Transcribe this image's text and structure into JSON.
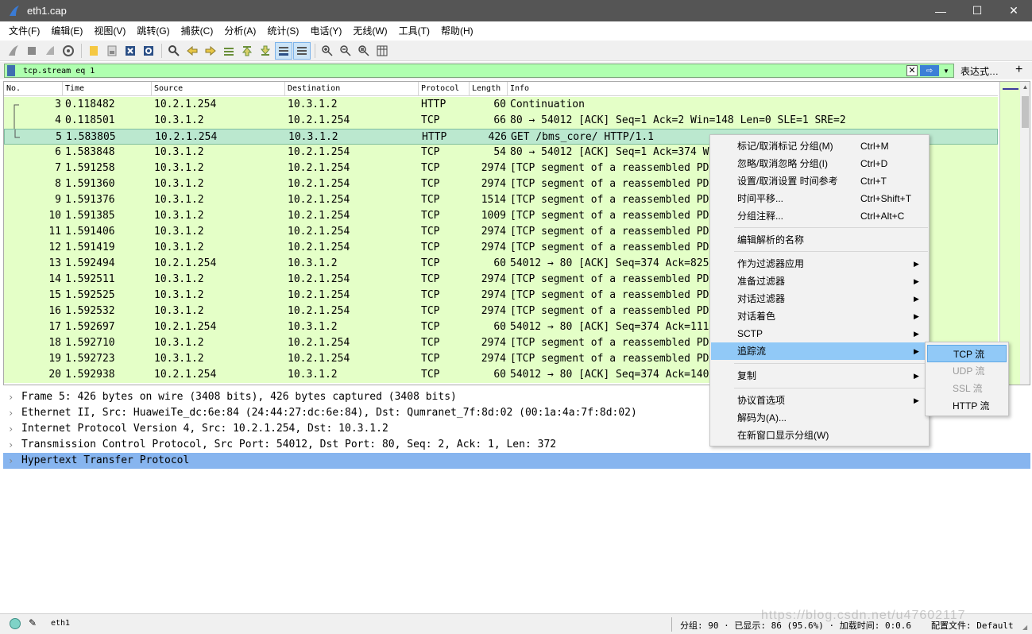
{
  "window": {
    "title": "eth1.cap",
    "minimize": "—",
    "maximize": "☐",
    "close": "✕"
  },
  "menu": [
    "文件(F)",
    "编辑(E)",
    "视图(V)",
    "跳转(G)",
    "捕获(C)",
    "分析(A)",
    "统计(S)",
    "电话(Y)",
    "无线(W)",
    "工具(T)",
    "帮助(H)"
  ],
  "filter": {
    "value": "tcp.stream eq 1",
    "clear": "✕",
    "apply": "⇨",
    "dropdown": "▼",
    "expression": "表达式…",
    "add": "+"
  },
  "columns": {
    "no": "No.",
    "time": "Time",
    "source": "Source",
    "destination": "Destination",
    "protocol": "Protocol",
    "length": "Length",
    "info": "Info"
  },
  "packets": [
    {
      "no": "3",
      "time": "0.118482",
      "src": "10.2.1.254",
      "dst": "10.3.1.2",
      "proto": "HTTP",
      "len": "60",
      "info": "Continuation"
    },
    {
      "no": "4",
      "time": "0.118501",
      "src": "10.3.1.2",
      "dst": "10.2.1.254",
      "proto": "TCP",
      "len": "66",
      "info": "80 → 54012 [ACK] Seq=1 Ack=2 Win=148 Len=0 SLE=1 SRE=2"
    },
    {
      "no": "5",
      "time": "1.583805",
      "src": "10.2.1.254",
      "dst": "10.3.1.2",
      "proto": "HTTP",
      "len": "426",
      "info": "GET /bms_core/ HTTP/1.1"
    },
    {
      "no": "6",
      "time": "1.583848",
      "src": "10.3.1.2",
      "dst": "10.2.1.254",
      "proto": "TCP",
      "len": "54",
      "info": "80 → 54012 [ACK] Seq=1 Ack=374 W"
    },
    {
      "no": "7",
      "time": "1.591258",
      "src": "10.3.1.2",
      "dst": "10.2.1.254",
      "proto": "TCP",
      "len": "2974",
      "info": "[TCP segment of a reassembled PD"
    },
    {
      "no": "8",
      "time": "1.591360",
      "src": "10.3.1.2",
      "dst": "10.2.1.254",
      "proto": "TCP",
      "len": "2974",
      "info": "[TCP segment of a reassembled PD"
    },
    {
      "no": "9",
      "time": "1.591376",
      "src": "10.3.1.2",
      "dst": "10.2.1.254",
      "proto": "TCP",
      "len": "1514",
      "info": "[TCP segment of a reassembled PD"
    },
    {
      "no": "10",
      "time": "1.591385",
      "src": "10.3.1.2",
      "dst": "10.2.1.254",
      "proto": "TCP",
      "len": "1009",
      "info": "[TCP segment of a reassembled PD"
    },
    {
      "no": "11",
      "time": "1.591406",
      "src": "10.3.1.2",
      "dst": "10.2.1.254",
      "proto": "TCP",
      "len": "2974",
      "info": "[TCP segment of a reassembled PD"
    },
    {
      "no": "12",
      "time": "1.591419",
      "src": "10.3.1.2",
      "dst": "10.2.1.254",
      "proto": "TCP",
      "len": "2974",
      "info": "[TCP segment of a reassembled PD"
    },
    {
      "no": "13",
      "time": "1.592494",
      "src": "10.2.1.254",
      "dst": "10.3.1.2",
      "proto": "TCP",
      "len": "60",
      "info": "54012 → 80 [ACK] Seq=374 Ack=825"
    },
    {
      "no": "14",
      "time": "1.592511",
      "src": "10.3.1.2",
      "dst": "10.2.1.254",
      "proto": "TCP",
      "len": "2974",
      "info": "[TCP segment of a reassembled PD"
    },
    {
      "no": "15",
      "time": "1.592525",
      "src": "10.3.1.2",
      "dst": "10.2.1.254",
      "proto": "TCP",
      "len": "2974",
      "info": "[TCP segment of a reassembled PD"
    },
    {
      "no": "16",
      "time": "1.592532",
      "src": "10.3.1.2",
      "dst": "10.2.1.254",
      "proto": "TCP",
      "len": "2974",
      "info": "[TCP segment of a reassembled PD"
    },
    {
      "no": "17",
      "time": "1.592697",
      "src": "10.2.1.254",
      "dst": "10.3.1.2",
      "proto": "TCP",
      "len": "60",
      "info": "54012 → 80 [ACK] Seq=374 Ack=111"
    },
    {
      "no": "18",
      "time": "1.592710",
      "src": "10.3.1.2",
      "dst": "10.2.1.254",
      "proto": "TCP",
      "len": "2974",
      "info": "[TCP segment of a reassembled PD"
    },
    {
      "no": "19",
      "time": "1.592723",
      "src": "10.3.1.2",
      "dst": "10.2.1.254",
      "proto": "TCP",
      "len": "2974",
      "info": "[TCP segment of a reassembled PD"
    },
    {
      "no": "20",
      "time": "1.592938",
      "src": "10.2.1.254",
      "dst": "10.3.1.2",
      "proto": "TCP",
      "len": "60",
      "info": "54012 → 80 [ACK] Seq=374 Ack=140"
    }
  ],
  "details": [
    "Frame 5: 426 bytes on wire (3408 bits), 426 bytes captured (3408 bits)",
    "Ethernet II, Src: HuaweiTe_dc:6e:84 (24:44:27:dc:6e:84), Dst: Qumranet_7f:8d:02 (00:1a:4a:7f:8d:02)",
    "Internet Protocol Version 4, Src: 10.2.1.254, Dst: 10.3.1.2",
    "Transmission Control Protocol, Src Port: 54012, Dst Port: 80, Seq: 2, Ack: 1, Len: 372",
    "Hypertext Transfer Protocol"
  ],
  "context_menu": {
    "mark": {
      "label": "标记/取消标记 分组(M)",
      "shortcut": "Ctrl+M"
    },
    "ignore": {
      "label": "忽略/取消忽略 分组(I)",
      "shortcut": "Ctrl+D"
    },
    "time_ref": {
      "label": "设置/取消设置 时间参考",
      "shortcut": "Ctrl+T"
    },
    "time_shift": {
      "label": "时间平移...",
      "shortcut": "Ctrl+Shift+T"
    },
    "comment": {
      "label": "分组注释...",
      "shortcut": "Ctrl+Alt+C"
    },
    "edit_resolved": "编辑解析的名称",
    "apply_filter": "作为过滤器应用",
    "prepare_filter": "准备过滤器",
    "conv_filter": "对话过滤器",
    "colorize": "对话着色",
    "sctp": "SCTP",
    "follow": "追踪流",
    "copy": "复制",
    "proto_prefs": "协议首选项",
    "decode_as": "解码为(A)...",
    "new_window": "在新窗口显示分组(W)",
    "arrow": "▶"
  },
  "submenu": {
    "tcp": "TCP 流",
    "udp": "UDP 流",
    "ssl": "SSL 流",
    "http": "HTTP 流"
  },
  "status": {
    "interface": "eth1",
    "packets": "分组: 90 · 已显示: 86 (95.6%) · 加载时间: 0:0.6",
    "profile": "配置文件: Default"
  },
  "watermark": "https://blog.csdn.net/u47602117"
}
